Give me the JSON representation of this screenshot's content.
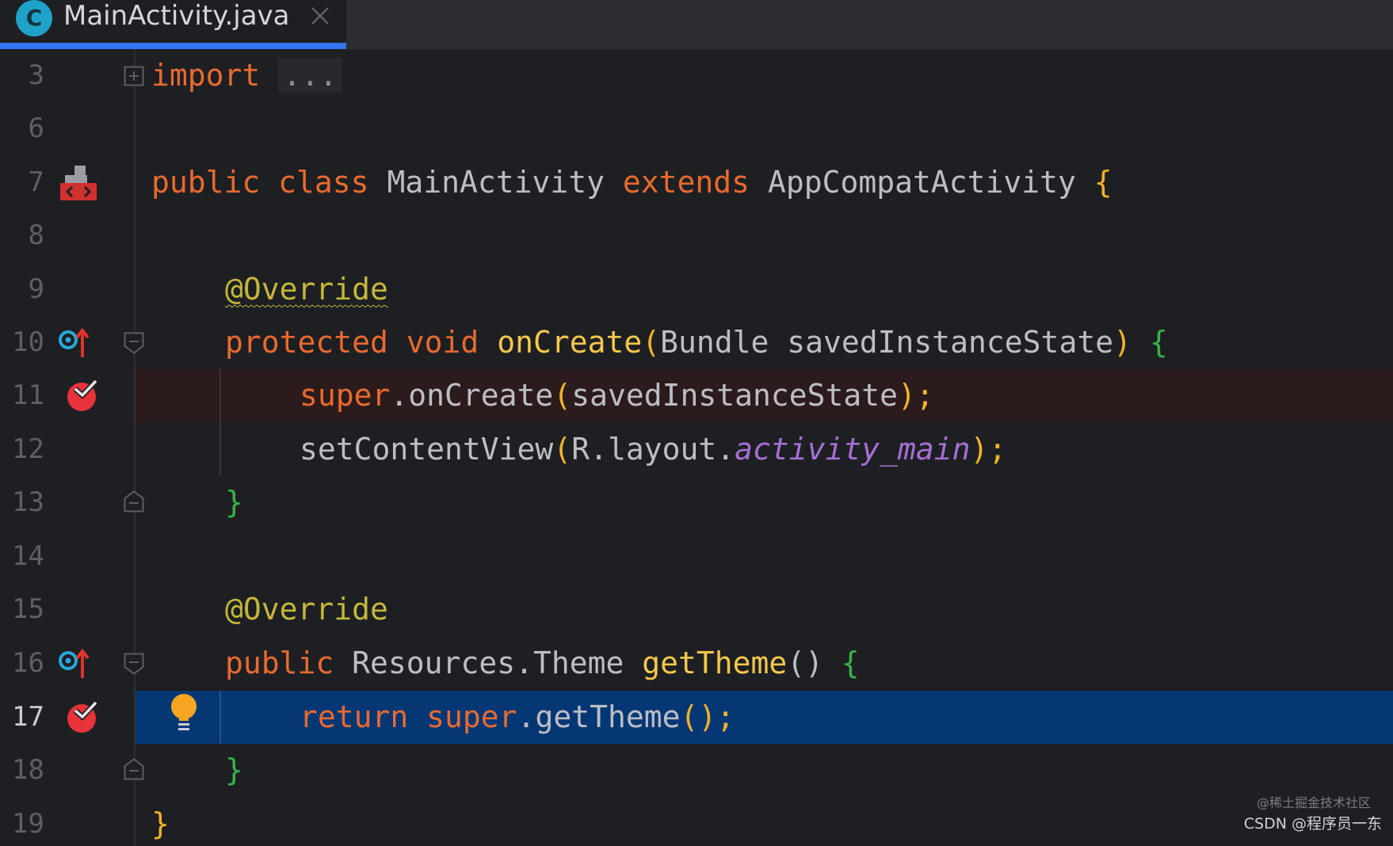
{
  "tab": {
    "icon_letter": "C",
    "title": "MainActivity.java"
  },
  "colors": {
    "keyword": "#e86a2f",
    "function": "#f5c84c",
    "annotation": "#c4b73b",
    "field_italic": "#a66fd6",
    "plain": "#bcbec4",
    "brace_green": "#38b24a",
    "brace_yellow": "#f0b429",
    "execution_line": "#053775",
    "breakpoint_line": "#2c1b1c",
    "tab_underline": "#3574f0"
  },
  "lines": {
    "l3": {
      "num": "3"
    },
    "l6": {
      "num": "6"
    },
    "l7": {
      "num": "7"
    },
    "l8": {
      "num": "8"
    },
    "l9": {
      "num": "9"
    },
    "l10": {
      "num": "10"
    },
    "l11": {
      "num": "11"
    },
    "l12": {
      "num": "12"
    },
    "l13": {
      "num": "13"
    },
    "l14": {
      "num": "14"
    },
    "l15": {
      "num": "15"
    },
    "l16": {
      "num": "16"
    },
    "l17": {
      "num": "17"
    },
    "l18": {
      "num": "18"
    },
    "l19": {
      "num": "19"
    }
  },
  "code": {
    "import_kw": "import",
    "import_fold": "...",
    "public": "public",
    "class": "class",
    "class_name": "MainActivity",
    "extends": "extends",
    "superclass": "AppCompatActivity",
    "open_brace": "{",
    "close_brace": "}",
    "override": "@Override",
    "protected": "protected",
    "void": "void",
    "on_create": "onCreate",
    "open_paren": "(",
    "close_paren": ")",
    "bundle_param": "Bundle savedInstanceState",
    "super": "super",
    "dot_on_create": ".onCreate",
    "saved_state": "savedInstanceState",
    "close_paren_semi": ");",
    "set_content_view": "setContentView",
    "r_layout": "R.layout.",
    "activity_main": "activity_main",
    "resources_theme": "Resources.Theme",
    "get_theme": "getTheme",
    "empty_parens": "()",
    "return": "return",
    "dot_get_theme": ".getTheme",
    "parens_semi": "();"
  },
  "icons": {
    "file": "java-class-icon",
    "close": "close-icon",
    "fold": "fold-icon",
    "layout": "related-layout-icon",
    "override": "overrides-method-icon",
    "breakpoint": "breakpoint-icon",
    "intention": "intention-bulb-icon"
  },
  "watermark": {
    "line1": "@稀土掘金技术社区",
    "line2": "CSDN @程序员一东"
  }
}
